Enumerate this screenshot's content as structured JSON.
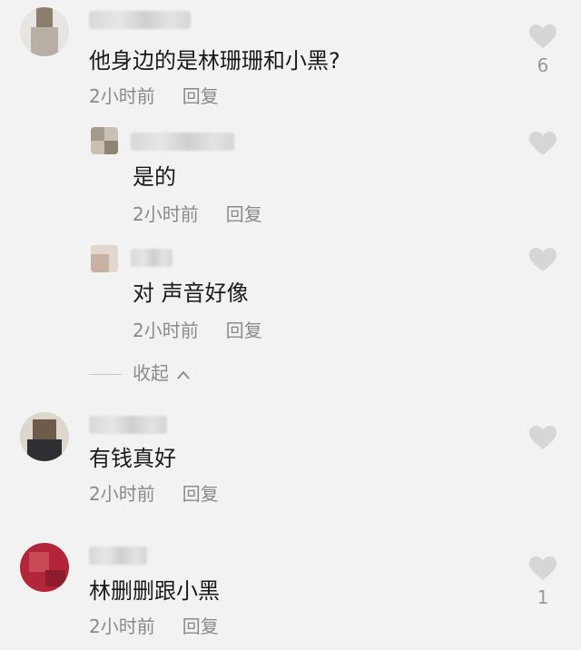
{
  "comments": [
    {
      "text": "他身边的是林珊珊和小黑?",
      "time": "2小时前",
      "reply": "回复",
      "likes": "6",
      "icon": "heart-icon",
      "replies": [
        {
          "text": "是的",
          "time": "2小时前",
          "reply": "回复",
          "icon": "heart-icon"
        },
        {
          "text": "对 声音好像",
          "time": "2小时前",
          "reply": "回复",
          "icon": "heart-icon"
        }
      ],
      "collapse_label": "收起"
    },
    {
      "text": "有钱真好",
      "time": "2小时前",
      "reply": "回复",
      "icon": "heart-icon"
    },
    {
      "text": "林删删跟小黑",
      "time": "2小时前",
      "reply": "回复",
      "likes": "1",
      "icon": "heart-icon"
    }
  ],
  "colors": {
    "background": "#f2f2f2",
    "heart": "#d6d6d6",
    "meta": "#8a8a8a"
  }
}
